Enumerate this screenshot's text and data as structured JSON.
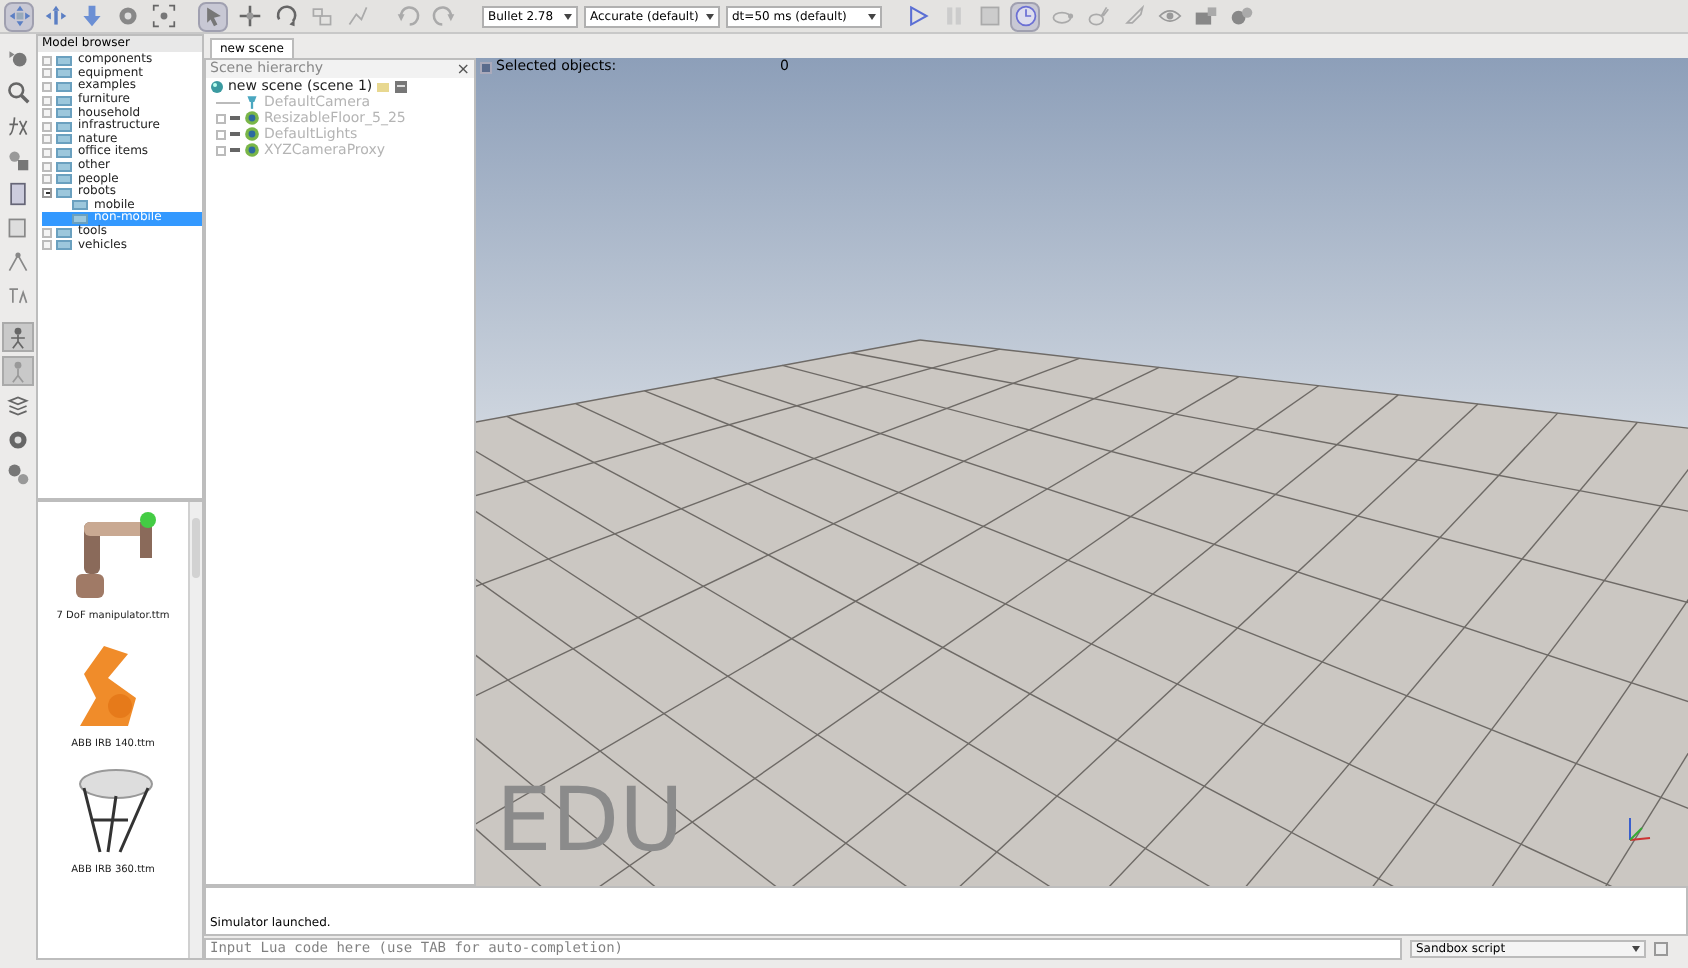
{
  "toolbar": {
    "buttons": [
      {
        "selected": true
      },
      {
        "selected": false
      },
      {
        "selected": false
      },
      {
        "selected": false
      },
      {
        "selected": false
      },
      {
        "selected": true
      },
      {
        "selected": false
      },
      {
        "selected": false
      },
      {
        "selected": false
      },
      {
        "selected": false
      },
      {
        "selected": false
      },
      {
        "selected": false
      }
    ],
    "dropdowns": [
      {
        "value": "Bullet 2.78"
      },
      {
        "value": "Accurate (default)"
      },
      {
        "value": "dt=50 ms (default)"
      }
    ],
    "sim_buttons": [
      {
        "selected": false
      },
      {
        "selected": false
      },
      {
        "selected": false
      },
      {
        "selected": true
      },
      {
        "selected": false
      },
      {
        "selected": false
      },
      {
        "selected": false
      },
      {
        "selected": false
      },
      {
        "selected": false
      },
      {
        "selected": false
      }
    ]
  },
  "side_toolbar": [
    {
      "selected": false
    },
    {
      "selected": false
    },
    {
      "selected": false
    },
    {
      "selected": false
    },
    {
      "selected": false
    },
    {
      "selected": false
    },
    {
      "selected": false
    },
    {
      "selected": false
    },
    {
      "selected": true
    },
    {
      "selected": true
    },
    {
      "selected": false
    },
    {
      "selected": false
    },
    {
      "selected": false
    }
  ],
  "model_browser": {
    "title": "Model browser",
    "items": [
      {
        "label": "components",
        "selected": false
      },
      {
        "label": "equipment",
        "selected": false
      },
      {
        "label": "examples",
        "selected": false
      },
      {
        "label": "furniture",
        "selected": false
      },
      {
        "label": "household",
        "selected": false
      },
      {
        "label": "infrastructure",
        "selected": false
      },
      {
        "label": "nature",
        "selected": false
      },
      {
        "label": "office items",
        "selected": false
      },
      {
        "label": "other",
        "selected": false
      },
      {
        "label": "people",
        "selected": false
      },
      {
        "label": "robots",
        "selected": false,
        "expanded": true,
        "children": [
          {
            "label": "mobile",
            "selected": false
          },
          {
            "label": "non-mobile",
            "selected": true
          }
        ]
      },
      {
        "label": "tools",
        "selected": false
      },
      {
        "label": "vehicles",
        "selected": false
      }
    ],
    "models": [
      {
        "label": "7 DoF manipulator.ttm",
        "kind": "arm"
      },
      {
        "label": "ABB IRB 140.ttm",
        "kind": "industrial"
      },
      {
        "label": "ABB IRB 360.ttm",
        "kind": "delta"
      }
    ]
  },
  "tab": {
    "label": "new scene",
    "selected": true
  },
  "scene_hierarchy": {
    "title": "Scene hierarchy",
    "close": "×",
    "root": {
      "label": "new scene (scene 1)",
      "children": [
        {
          "label": "DefaultCamera",
          "kind": "camera"
        },
        {
          "label": "ResizableFloor_5_25",
          "kind": "shape"
        },
        {
          "label": "DefaultLights",
          "kind": "shape"
        },
        {
          "label": "XYZCameraProxy",
          "kind": "shape"
        }
      ]
    }
  },
  "viewport": {
    "selected_label": "Selected objects:",
    "selected_count": "0",
    "watermark": "EDU"
  },
  "console": {
    "message": "Simulator launched.",
    "placeholder": "Input Lua code here (use TAB for auto-completion)",
    "script_select": "Sandbox script"
  }
}
